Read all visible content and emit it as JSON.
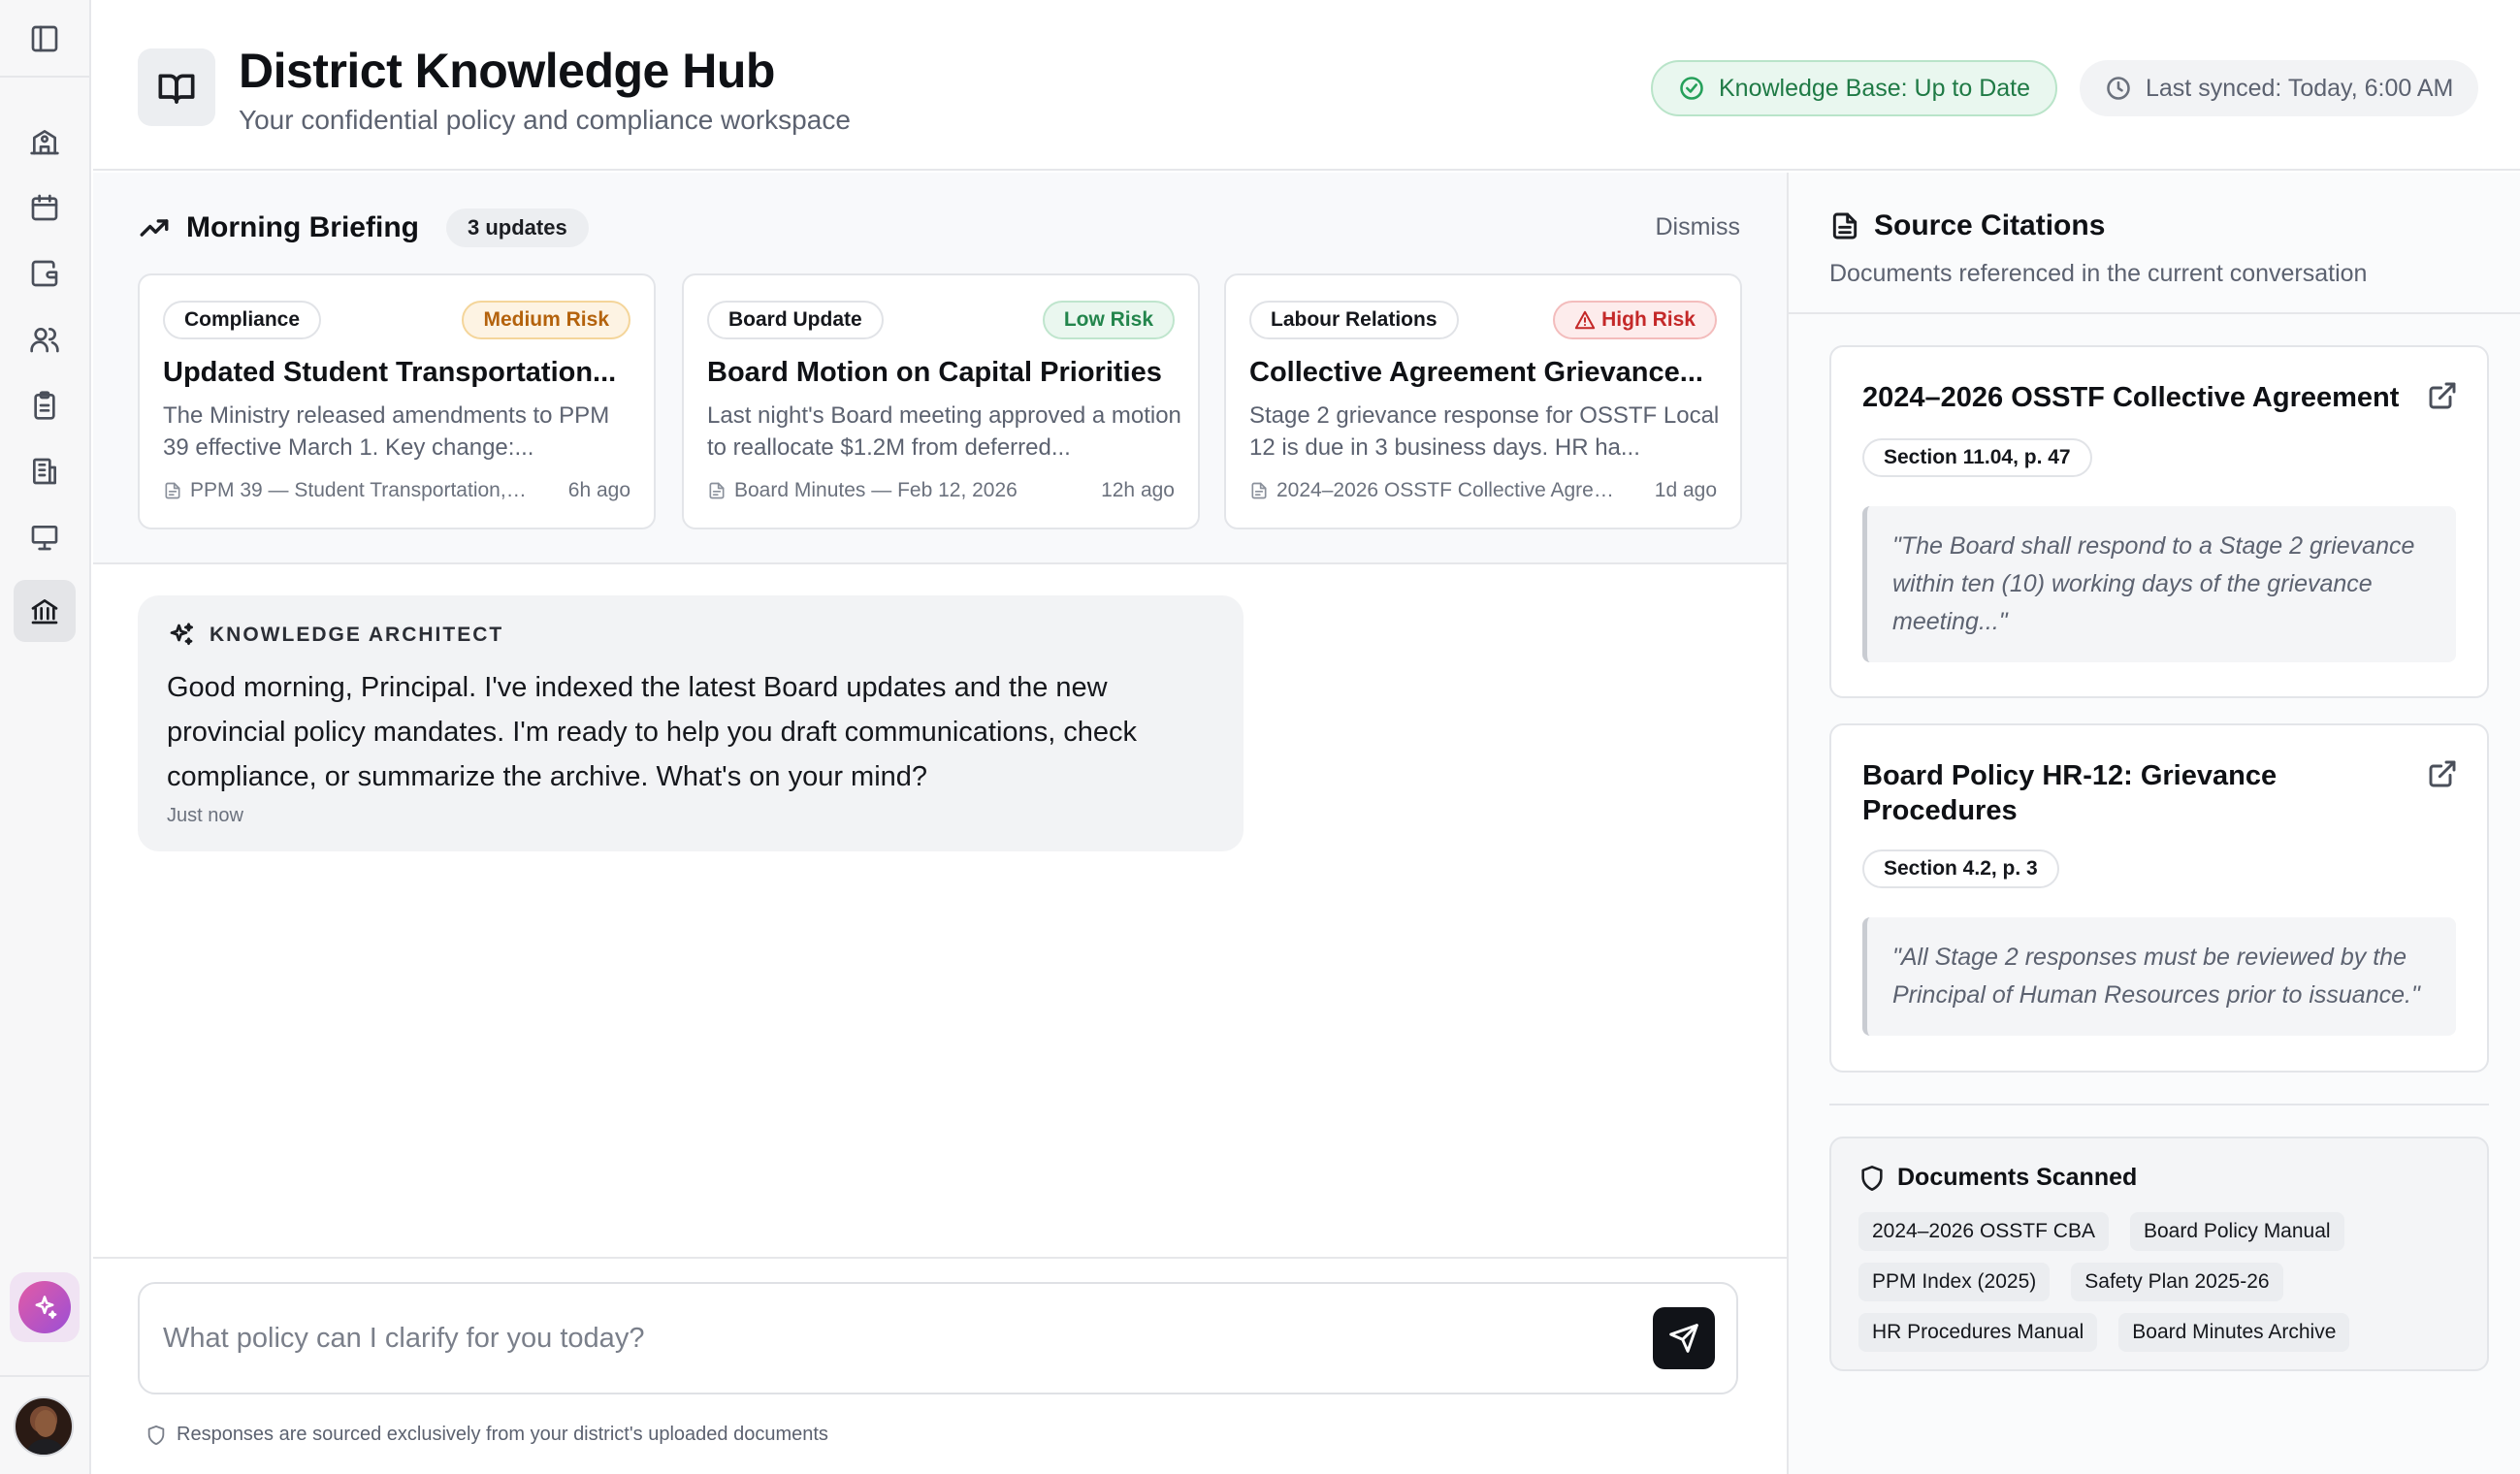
{
  "header": {
    "title": "District Knowledge Hub",
    "subtitle": "Your confidential policy and compliance workspace",
    "kb_status": "Knowledge Base: Up to Date",
    "last_synced": "Last synced: Today, 6:00 AM"
  },
  "sidebar": {
    "items": [
      {
        "icon": "panel-toggle-icon"
      },
      {
        "icon": "school-icon"
      },
      {
        "icon": "calendar-icon"
      },
      {
        "icon": "wallet-icon"
      },
      {
        "icon": "users-icon"
      },
      {
        "icon": "clipboard-icon"
      },
      {
        "icon": "building-icon"
      },
      {
        "icon": "presentation-icon"
      },
      {
        "icon": "landmark-icon",
        "active": true
      }
    ],
    "assistant_icon": "sparkles-icon",
    "avatar": "user-avatar"
  },
  "briefing": {
    "title": "Morning Briefing",
    "count": "3 updates",
    "dismiss": "Dismiss",
    "cards": [
      {
        "category": "Compliance",
        "risk": "Medium Risk",
        "title": "Updated Student Transportation...",
        "description": "The Ministry released amendments to PPM 39 effective March 1. Key change:...",
        "source": "PPM 39 — Student Transportation, 20...",
        "time": "6h ago"
      },
      {
        "category": "Board Update",
        "risk": "Low Risk",
        "title": "Board Motion on Capital Priorities",
        "description": "Last night's Board meeting approved a motion to reallocate $1.2M from deferred...",
        "source": "Board Minutes — Feb 12, 2026",
        "time": "12h ago"
      },
      {
        "category": "Labour Relations",
        "risk": "High Risk",
        "title": "Collective Agreement Grievance...",
        "description": "Stage 2 grievance response for OSSTF Local 12 is due in 3 business days. HR ha...",
        "source": "2024–2026 OSSTF Collective Agreem...",
        "time": "1d ago"
      }
    ]
  },
  "chat": {
    "author": "KNOWLEDGE ARCHITECT",
    "message": "Good morning, Principal. I've indexed the latest Board updates and the new provincial policy mandates. I'm ready to help you draft communications, check compliance, or summarize the archive. What's on your mind?",
    "time": "Just now"
  },
  "composer": {
    "placeholder": "What policy can I clarify for you today?",
    "disclaimer": "Responses are sourced exclusively from your district's uploaded documents"
  },
  "citations": {
    "title": "Source Citations",
    "subtitle": "Documents referenced in the current conversation",
    "items": [
      {
        "title": "2024–2026 OSSTF Collective Agreement",
        "section": "Section 11.04, p. 47",
        "quote": "\"The Board shall respond to a Stage 2 grievance within ten (10) working days of the grievance meeting...\""
      },
      {
        "title": "Board Policy HR-12: Grievance Procedures",
        "section": "Section 4.2, p. 3",
        "quote": "\"All Stage 2 responses must be reviewed by the Principal of Human Resources prior to issuance.\""
      }
    ]
  },
  "scanned": {
    "title": "Documents Scanned",
    "tags": [
      "2024–2026 OSSTF CBA",
      "Board Policy Manual",
      "PPM Index (2025)",
      "Safety Plan 2025-26",
      "HR Procedures Manual",
      "Board Minutes Archive"
    ]
  }
}
